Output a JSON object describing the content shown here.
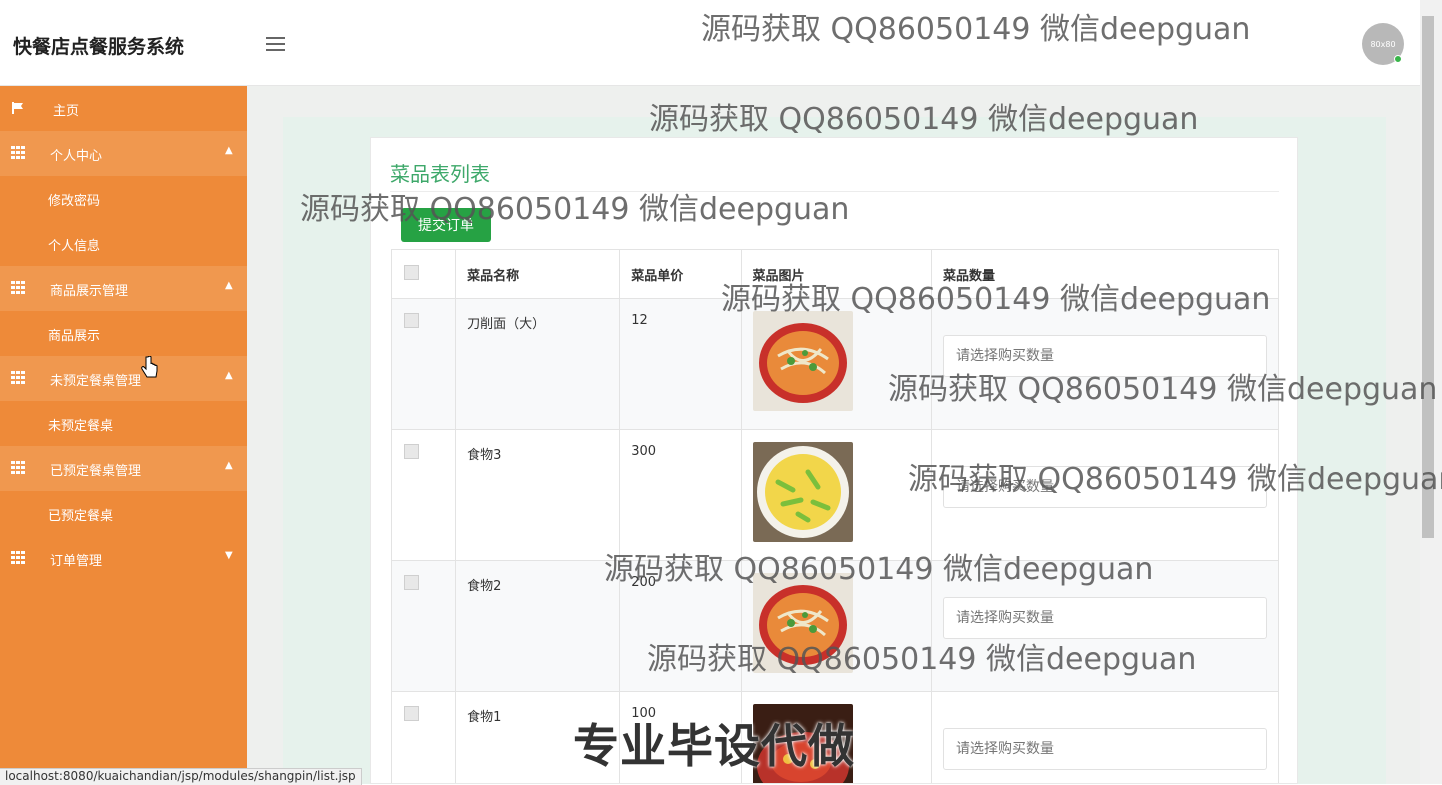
{
  "header": {
    "app_title": "快餐店点餐服务系统",
    "avatar_text": "80x80"
  },
  "sidebar": {
    "items": [
      {
        "label": "主页",
        "type": "home"
      },
      {
        "label": "个人中心",
        "type": "group"
      },
      {
        "label": "修改密码",
        "type": "sub"
      },
      {
        "label": "个人信息",
        "type": "sub"
      },
      {
        "label": "商品展示管理",
        "type": "group"
      },
      {
        "label": "商品展示",
        "type": "sub"
      },
      {
        "label": "未预定餐桌管理",
        "type": "group"
      },
      {
        "label": "未预定餐桌",
        "type": "sub"
      },
      {
        "label": "已预定餐桌管理",
        "type": "group"
      },
      {
        "label": "已预定餐桌",
        "type": "sub"
      },
      {
        "label": "订单管理",
        "type": "group"
      }
    ]
  },
  "main": {
    "title": "菜品表列表",
    "submit_label": "提交订单",
    "columns": [
      "菜品名称",
      "菜品单价",
      "菜品图片",
      "菜品数量"
    ],
    "rows": [
      {
        "name": "刀削面（大）",
        "price": "12",
        "qty_placeholder": "请选择购买数量"
      },
      {
        "name": "食物3",
        "price": "300",
        "qty_placeholder": "请选择购买数量"
      },
      {
        "name": "食物2",
        "price": "200",
        "qty_placeholder": "请选择购买数量"
      },
      {
        "name": "食物1",
        "price": "100",
        "qty_placeholder": "请选择购买数量"
      }
    ]
  },
  "status_bar": "localhost:8080/kuaichandian/jsp/modules/shangpin/list.jsp",
  "watermarks": {
    "text": "源码获取 QQ86050149 微信deepguan",
    "big_text": "专业毕设代做"
  },
  "colors": {
    "sidebar": "#ee8a39",
    "accent": "#3ea86a",
    "button": "#26a244"
  }
}
